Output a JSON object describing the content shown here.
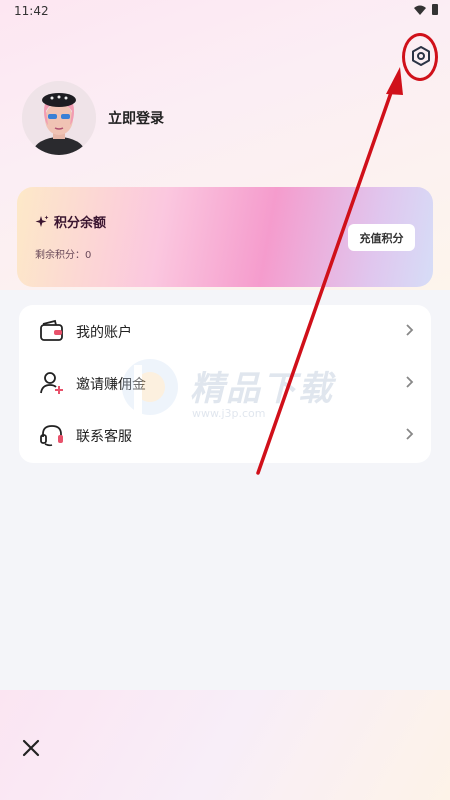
{
  "status_bar": {
    "time": "11:42"
  },
  "profile": {
    "login_text": "立即登录"
  },
  "points_card": {
    "title": "积分余额",
    "remaining_label": "剩余积分：",
    "remaining_value": "0",
    "recharge_label": "充值积分"
  },
  "menu": {
    "items": [
      {
        "label": "我的账户",
        "icon": "wallet-icon"
      },
      {
        "label": "邀请赚佣金",
        "icon": "invite-user-icon"
      },
      {
        "label": "联系客服",
        "icon": "headset-icon"
      }
    ]
  },
  "watermark": {
    "title": "精品下载",
    "url": "www.j3p.com"
  },
  "colors": {
    "annotation_red": "#d0101a",
    "card_pink": "#f59ccd"
  }
}
